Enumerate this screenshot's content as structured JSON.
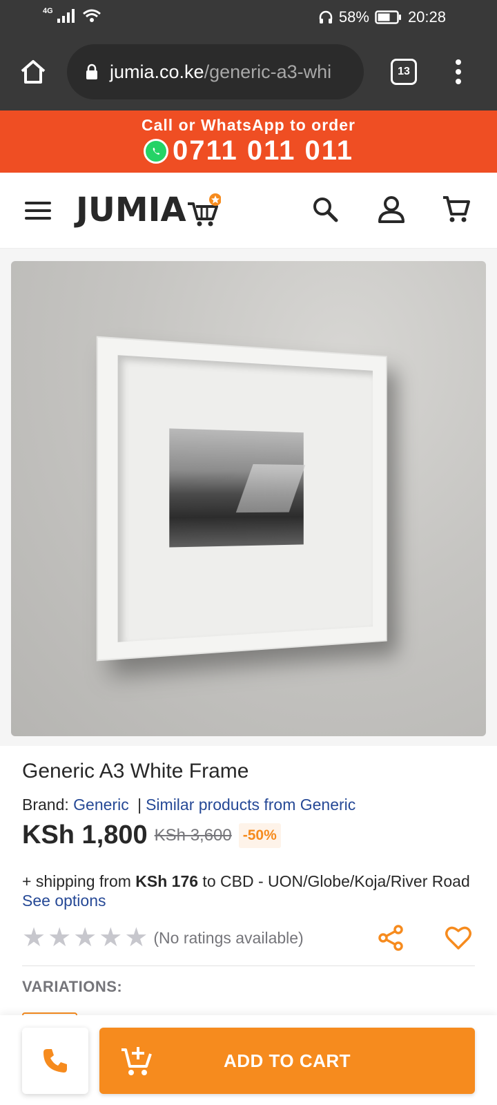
{
  "status_bar": {
    "network": "4G",
    "battery": "58%",
    "time": "20:28"
  },
  "browser": {
    "url_host": "jumia.co.ke",
    "url_path": "/generic-a3-whi",
    "tab_count": "13"
  },
  "promo": {
    "line1": "Call or WhatsApp to order",
    "phone": "0711 011 011"
  },
  "header": {
    "logo": "JUMIA"
  },
  "product": {
    "title": "Generic A3 White Frame",
    "brand_label": "Brand:",
    "brand_name": "Generic",
    "separator": "|",
    "similar_link": "Similar products from Generic",
    "price": "KSh 1,800",
    "old_price": "KSh 3,600",
    "discount": "-50%",
    "shipping_prefix": "+ shipping from ",
    "shipping_amount": "KSh 176",
    "shipping_suffix": " to CBD - UON/Globe/Koja/River Road ",
    "see_options": "See options",
    "rating": 0,
    "rating_max": 5,
    "ratings_text": "(No ratings available)",
    "variations_label": "VARIATIONS:"
  },
  "actions": {
    "add_to_cart": "ADD TO CART"
  },
  "colors": {
    "accent_orange": "#f68b1e",
    "promo_red": "#ef4e23",
    "link_blue": "#264996",
    "chrome_dark": "#393939"
  }
}
